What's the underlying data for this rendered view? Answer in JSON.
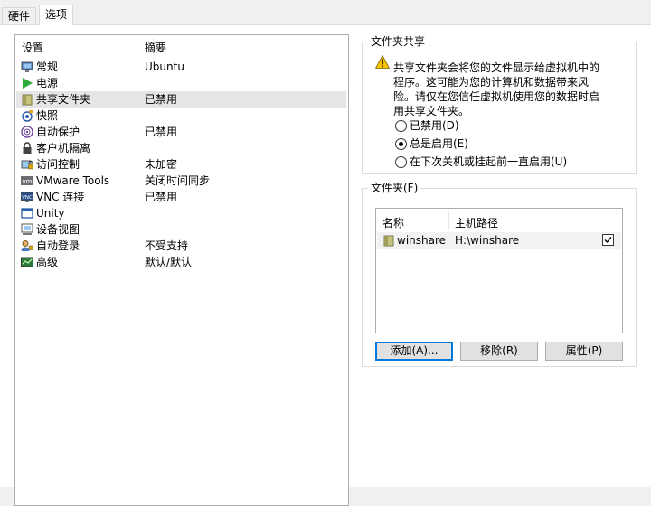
{
  "tabs": [
    {
      "label": "硬件",
      "active": false
    },
    {
      "label": "选项",
      "active": true
    }
  ],
  "settings_list": {
    "columns": [
      "设置",
      "摘要"
    ],
    "rows": [
      {
        "label": "常规",
        "summary": "Ubuntu",
        "icon": "monitor-icon"
      },
      {
        "label": "电源",
        "summary": "",
        "icon": "power-play-icon"
      },
      {
        "label": "共享文件夹",
        "summary": "已禁用",
        "icon": "shared-folder-icon",
        "selected": true
      },
      {
        "label": "快照",
        "summary": "",
        "icon": "snapshot-icon"
      },
      {
        "label": "自动保护",
        "summary": "已禁用",
        "icon": "autoprotect-icon"
      },
      {
        "label": "客户机隔离",
        "summary": "",
        "icon": "lock-icon"
      },
      {
        "label": "访问控制",
        "summary": "未加密",
        "icon": "access-control-icon"
      },
      {
        "label": "VMware Tools",
        "summary": "关闭时间同步",
        "icon": "vmware-tools-icon"
      },
      {
        "label": "VNC 连接",
        "summary": "已禁用",
        "icon": "vnc-icon"
      },
      {
        "label": "Unity",
        "summary": "",
        "icon": "unity-icon"
      },
      {
        "label": "设备视图",
        "summary": "",
        "icon": "device-view-icon"
      },
      {
        "label": "自动登录",
        "summary": "不受支持",
        "icon": "autologin-icon"
      },
      {
        "label": "高级",
        "summary": "默认/默认",
        "icon": "advanced-icon"
      }
    ]
  },
  "folder_sharing": {
    "title": "文件夹共享",
    "warning": "共享文件夹会将您的文件显示给虚拟机中的程序。这可能为您的计算机和数据带来风险。请仅在您信任虚拟机使用您的数据时启用共享文件夹。",
    "options": [
      {
        "label": "已禁用(D)",
        "checked": false
      },
      {
        "label": "总是启用(E)",
        "checked": true
      },
      {
        "label": "在下次关机或挂起前一直启用(U)",
        "checked": false
      }
    ]
  },
  "folders": {
    "title": "文件夹(F)",
    "columns": [
      "名称",
      "主机路径"
    ],
    "rows": [
      {
        "name": "winshare",
        "path": "H:\\winshare",
        "enabled": true
      }
    ],
    "buttons": {
      "add": "添加(A)...",
      "remove": "移除(R)",
      "properties": "属性(P)"
    }
  }
}
